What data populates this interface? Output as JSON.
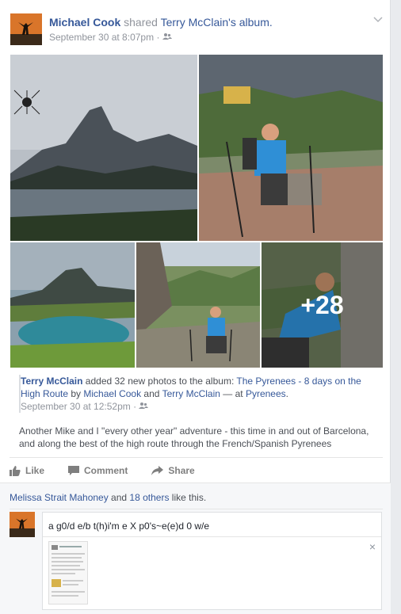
{
  "post": {
    "author": "Michael Cook",
    "action": "shared",
    "owner": "Terry McClain",
    "owner_suffix": "'s",
    "object": "album.",
    "timestamp": "September 30 at 8:07pm",
    "separator": "·",
    "audience_icon": "friends-icon",
    "menu_icon": "chevron-down-icon"
  },
  "photos": {
    "more_count": "+28"
  },
  "attachment": {
    "actor": "Terry McClain",
    "text1": " added 32 new photos to the album: ",
    "album": "The Pyrenees - 8 days on the High Route",
    "by": " by ",
    "tag1": "Michael Cook",
    "and": " and ",
    "tag2": "Terry McClain",
    "at": " — at ",
    "place": "Pyrenees",
    "period": ".",
    "timestamp": "September 30 at 12:52pm",
    "separator": "·",
    "description": "Another Mike and I \"every other year\" adventure - this time in and out of Barcelona, and along the best of the high route through the French/Spanish Pyrenees"
  },
  "actions": {
    "like": "Like",
    "comment": "Comment",
    "share": "Share"
  },
  "ufi": {
    "liker": "Melissa Strait Mahoney",
    "and": " and ",
    "others": "18 others",
    "suffix": " like this."
  },
  "comment_box": {
    "value": "a g0/d e/b t(h)i'm e X p0's~e(e)d 0 w/e",
    "close": "×"
  },
  "colors": {
    "link": "#365899",
    "meta": "#90949c",
    "text": "#4b4f56"
  }
}
